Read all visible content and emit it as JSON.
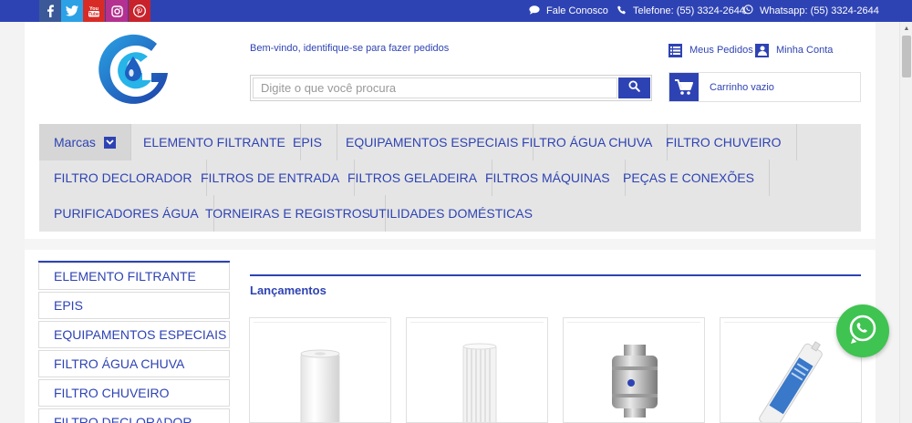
{
  "social": [
    {
      "name": "facebook",
      "icon": "facebook-icon"
    },
    {
      "name": "twitter",
      "icon": "twitter-icon"
    },
    {
      "name": "youtube",
      "icon": "youtube-icon"
    },
    {
      "name": "instagram",
      "icon": "instagram-icon"
    },
    {
      "name": "pinterest",
      "icon": "pinterest-icon"
    }
  ],
  "topbar": {
    "fale_conosco": "Fale Conosco",
    "telefone": "Telefone: (55) 3324-2644",
    "whatsapp": "Whatsapp: (55) 3324-2644"
  },
  "header": {
    "welcome": "Bem-vindo, identifique-se para fazer pedidos",
    "search_placeholder": "Digite o que você procura",
    "meus_pedidos": "Meus Pedidos",
    "minha_conta": "Minha Conta",
    "cart_label": "Carrinho vazio"
  },
  "nav": {
    "marcas": "Marcas",
    "items": [
      "ELEMENTO FILTRANTE",
      "EPIS",
      "EQUIPAMENTOS ESPECIAIS",
      "FILTRO ÁGUA CHUVA",
      "FILTRO CHUVEIRO",
      "FILTRO DECLORADOR",
      "FILTROS DE ENTRADA",
      "FILTROS GELADEIRA",
      "FILTROS MÁQUINAS",
      "PEÇAS E CONEXÕES",
      "PURIFICADORES ÁGUA",
      "TORNEIRAS E REGISTROS",
      "UTILIDADES DOMÉSTICAS"
    ]
  },
  "sidebar": {
    "items": [
      "ELEMENTO FILTRANTE",
      "EPIS",
      "EQUIPAMENTOS ESPECIAIS",
      "FILTRO ÁGUA CHUVA",
      "FILTRO CHUVEIRO",
      "FILTRO DECLORADOR"
    ]
  },
  "content": {
    "section_title": "Lançamentos"
  },
  "colors": {
    "primary": "#2e43b3",
    "nav_bg": "#e5e5e5",
    "whatsapp": "#3fc351"
  }
}
